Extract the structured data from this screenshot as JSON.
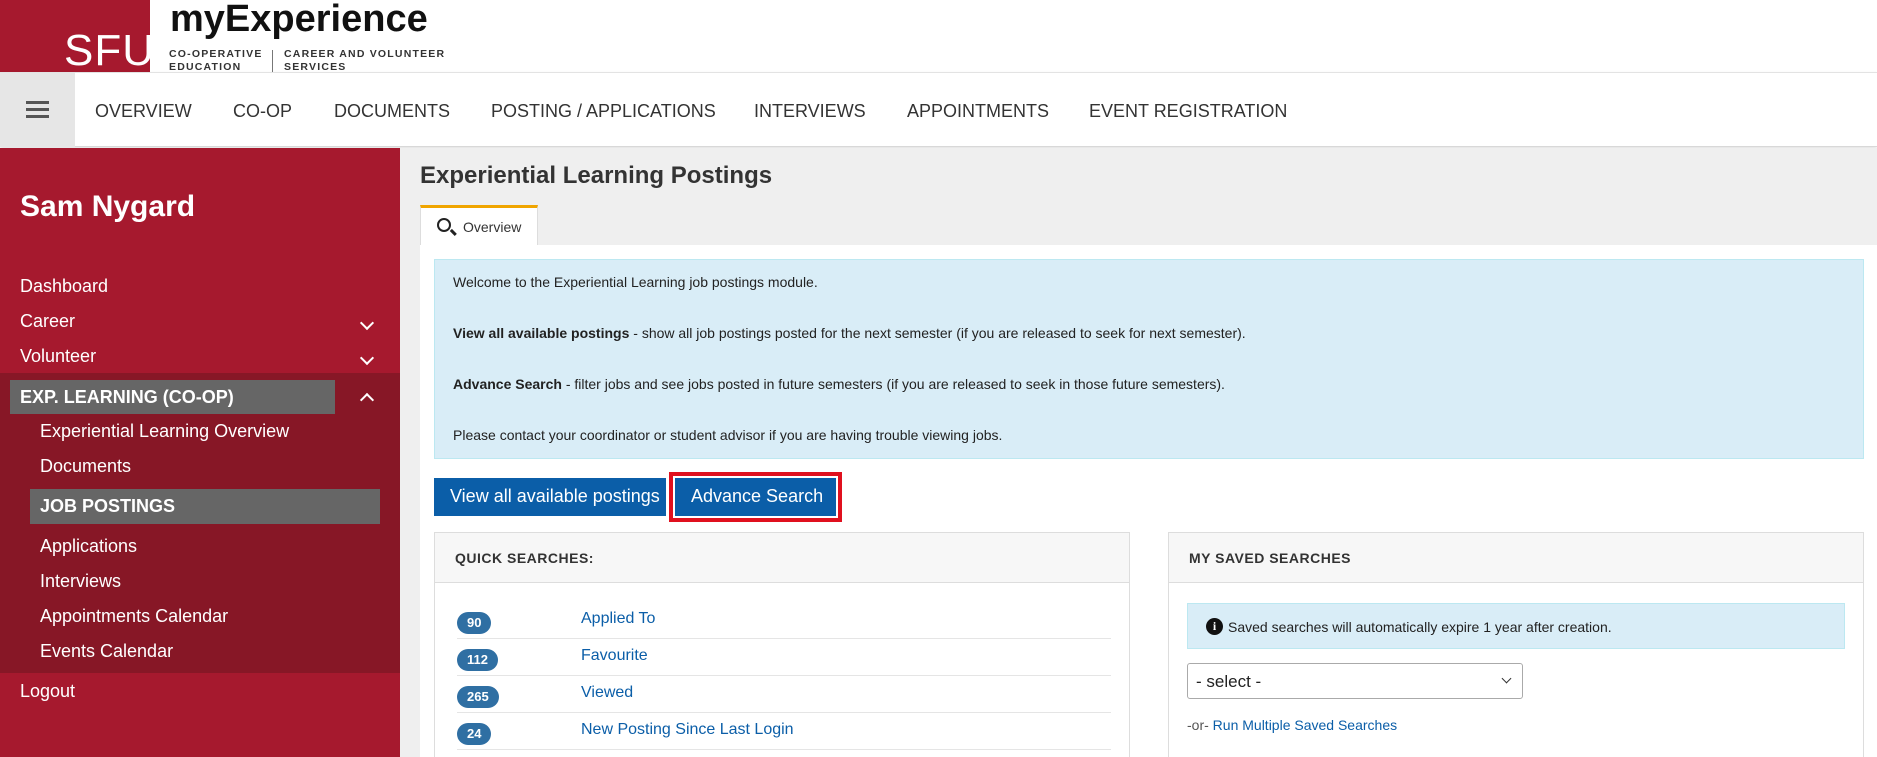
{
  "brand": {
    "logo": "SFU",
    "title": "myExperience",
    "sub1_line1": "CO-OPERATIVE",
    "sub1_line2": "EDUCATION",
    "sub2_line1": "CAREER AND VOLUNTEER",
    "sub2_line2": "SERVICES"
  },
  "topnav": {
    "items": [
      "OVERVIEW",
      "CO-OP",
      "DOCUMENTS",
      "POSTING / APPLICATIONS",
      "INTERVIEWS",
      "APPOINTMENTS",
      "EVENT REGISTRATION"
    ]
  },
  "sidebar": {
    "user_name": "Sam Nygard",
    "items": [
      "Dashboard",
      "Career",
      "Volunteer"
    ],
    "section_label": "EXP. LEARNING (CO-OP)",
    "sub_items": [
      "Experiential Learning Overview",
      "Documents",
      "JOB POSTINGS",
      "Applications",
      "Interviews",
      "Appointments Calendar",
      "Events Calendar"
    ],
    "logout": "Logout"
  },
  "main": {
    "page_title": "Experiential Learning Postings",
    "tab_label": "Overview",
    "info": {
      "line1": "Welcome to the Experiential Learning job postings module.",
      "line2_bold": "View all available postings",
      "line2_rest": " - show all job postings posted for the next semester (if you are released to seek for next semester).",
      "line3_bold": "Advance Search",
      "line3_rest": " - filter jobs and see jobs posted in future semesters (if you are released to seek in those future semesters).",
      "line4": "Please contact your coordinator or student advisor if you are having trouble viewing jobs."
    },
    "buttons": {
      "view_all": "View all available postings",
      "advance_search": "Advance Search"
    },
    "quick_searches": {
      "title": "QUICK SEARCHES:",
      "items": [
        {
          "count": "90",
          "label": "Applied To"
        },
        {
          "count": "112",
          "label": "Favourite"
        },
        {
          "count": "265",
          "label": "Viewed"
        },
        {
          "count": "24",
          "label": "New Posting Since Last Login"
        }
      ]
    },
    "saved_searches": {
      "title": "MY SAVED SEARCHES",
      "info_text": "Saved searches will automatically expire 1 year after creation.",
      "select_value": "- select -",
      "or_prefix": "-or- ",
      "run_multiple": "Run Multiple Saved Searches"
    }
  },
  "colors": {
    "brand_red": "#a6192e",
    "sidebar_dark": "#871726",
    "active_gray": "#666666",
    "button_blue": "#0b5ea8",
    "info_bg": "#d9edf7",
    "highlight_red": "#e0101e",
    "tab_accent": "#f0a500"
  },
  "icons": [
    "hamburger-icon",
    "search-icon",
    "chevron-down-icon",
    "chevron-up-icon",
    "info-icon"
  ]
}
